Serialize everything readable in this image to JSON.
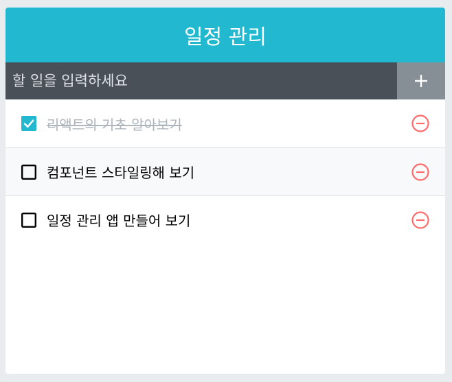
{
  "header": {
    "title": "일정 관리"
  },
  "insert": {
    "placeholder": "할 일을 입력하세요",
    "button_icon": "plus-icon"
  },
  "todos": [
    {
      "text": "리액트의 기초 알아보기",
      "checked": true
    },
    {
      "text": "컴포넌트 스타일링해 보기",
      "checked": false
    },
    {
      "text": "일정 관리 앱 만들어 보기",
      "checked": false
    }
  ],
  "colors": {
    "accent": "#22b8cf",
    "input_bg": "#495057",
    "button_bg": "#868e96",
    "remove": "#ff6b6b",
    "checked_text": "#adb5bd"
  }
}
